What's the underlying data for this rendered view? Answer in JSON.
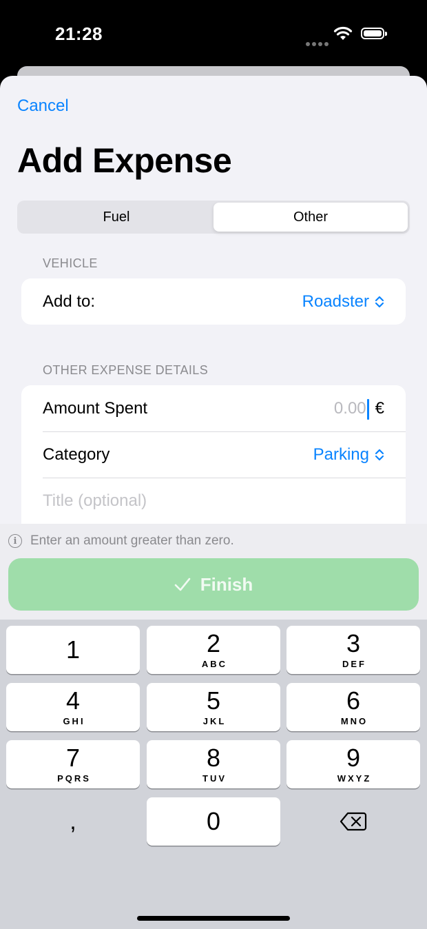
{
  "status_bar": {
    "time": "21:28"
  },
  "header": {
    "cancel_label": "Cancel",
    "title": "Add Expense"
  },
  "segments": {
    "left": "Fuel",
    "right": "Other",
    "selected": "Other"
  },
  "vehicle_section": {
    "label": "VEHICLE",
    "add_to_label": "Add to:",
    "vehicle_value": "Roadster"
  },
  "details_section": {
    "label": "OTHER EXPENSE DETAILS",
    "amount_label": "Amount Spent",
    "amount_placeholder": "0.00",
    "currency": "€",
    "category_label": "Category",
    "category_value": "Parking",
    "title_placeholder": "Title (optional)"
  },
  "footer": {
    "hint": "Enter an amount greater than zero.",
    "finish_label": "Finish"
  },
  "keypad": [
    {
      "num": "1",
      "letters": ""
    },
    {
      "num": "2",
      "letters": "ABC"
    },
    {
      "num": "3",
      "letters": "DEF"
    },
    {
      "num": "4",
      "letters": "GHI"
    },
    {
      "num": "5",
      "letters": "JKL"
    },
    {
      "num": "6",
      "letters": "MNO"
    },
    {
      "num": "7",
      "letters": "PQRS"
    },
    {
      "num": "8",
      "letters": "TUV"
    },
    {
      "num": "9",
      "letters": "WXYZ"
    },
    {
      "num": ",",
      "letters": ""
    },
    {
      "num": "0",
      "letters": ""
    }
  ],
  "colors": {
    "accent": "#0a84ff",
    "finish_disabled": "#9fddaa",
    "background": "#f2f2f7"
  }
}
